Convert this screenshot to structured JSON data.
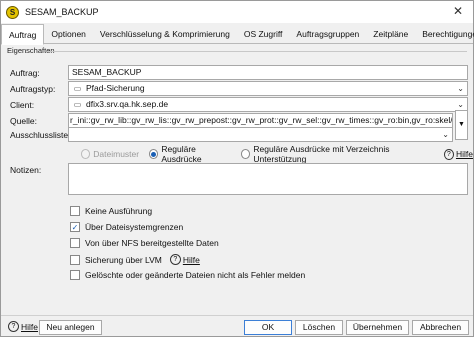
{
  "window": {
    "title": "SESAM_BACKUP",
    "app_icon": "sesam-icon"
  },
  "tabs": [
    {
      "label": "Auftrag"
    },
    {
      "label": "Optionen"
    },
    {
      "label": "Verschlüsselung & Komprimierung"
    },
    {
      "label": "OS Zugriff"
    },
    {
      "label": "Auftragsgruppen"
    },
    {
      "label": "Zeitpläne"
    },
    {
      "label": "Berechtigungen"
    }
  ],
  "properties": {
    "section_label": "Eigenschaften",
    "auftrag_label": "Auftrag:",
    "auftrag_value": "SESAM_BACKUP",
    "auftragstyp_label": "Auftragstyp:",
    "auftragstyp_value": "Pfad-Sicherung",
    "client_label": "Client:",
    "client_value": "dfix3.srv.qa.hk.sep.de",
    "quelle_label": "Quelle:",
    "quelle_value": "r_ini::gv_rw_lib::gv_rw_lis::gv_rw_prepost::gv_rw_prot::gv_rw_sel::gv_rw_times::gv_ro:bin,gv_ro:skel/templates",
    "ausschlussliste_label": "Ausschlussliste:",
    "ausschlussliste_value": ""
  },
  "pattern": {
    "options": [
      "Dateimuster",
      "Reguläre Ausdrücke",
      "Reguläre Ausdrücke mit Verzeichnis Unterstützung"
    ],
    "selected": "Reguläre Ausdrücke",
    "help_label": "Hilfe"
  },
  "notes": {
    "label": "Notizen:",
    "value": ""
  },
  "checkboxes": [
    {
      "label": "Keine Ausführung",
      "checked": false
    },
    {
      "label": "Über Dateisystemgrenzen",
      "checked": true
    },
    {
      "label": "Von über NFS bereitgestellte Daten",
      "checked": false
    },
    {
      "label": "Sicherung über LVM",
      "checked": false,
      "help_label": "Hilfe"
    },
    {
      "label": "Gelöschte oder geänderte Dateien nicht als Fehler melden",
      "checked": false
    }
  ],
  "footer": {
    "help_label": "Hilfe",
    "new_label": "Neu anlegen",
    "ok_label": "OK",
    "delete_label": "Löschen",
    "apply_label": "Übernehmen",
    "cancel_label": "Abbrechen"
  }
}
